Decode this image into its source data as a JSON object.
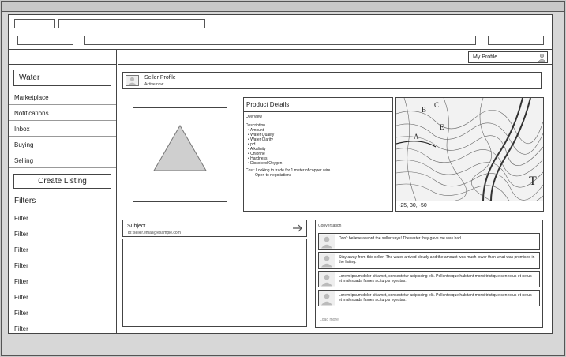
{
  "sidebar": {
    "search_value": "Water",
    "nav": [
      "Marketplace",
      "Notifications",
      "Inbox",
      "Buying",
      "Selling"
    ],
    "create_listing": "Create Listing",
    "filters_heading": "Filters",
    "filters": [
      "Filter",
      "Filter",
      "Filter",
      "Filter",
      "Filter",
      "Filter",
      "Filter",
      "Filter"
    ]
  },
  "header": {
    "profile_label": "My Profile"
  },
  "seller": {
    "title": "Seller Profile",
    "subtitle": "Active now"
  },
  "product": {
    "title": "Product Details",
    "overview": "Overview",
    "description_label": "Description",
    "attributes": [
      "Amount",
      "Water Quality",
      "Water Clarity",
      "pH",
      "Alkalinity",
      "Chlorine",
      "Hardness",
      "Dissolved Oxygen"
    ],
    "note_line1": "Cost: Looking to trade for 1 meter of copper wire",
    "note_line2": "Open to negotiations"
  },
  "map": {
    "labels": [
      "A",
      "B",
      "C",
      "E",
      "T"
    ],
    "caption": "-25, 30, -50"
  },
  "message": {
    "subject": "Subject",
    "to": "To: seller.email@example.com"
  },
  "messages": {
    "title": "Conversation",
    "items": [
      "Don't believe a word the seller says! The water they gave me was bad.",
      "Stay away from this seller! The water arrived cloudy and the amount was much lower than what was promised in the listing.",
      "Lorem ipsum dolor sit amet, consectetur adipiscing elit. Pellentesque habitant morbi tristique senectus et netus et malesuada fames ac turpis egestas.",
      "Lorem ipsum dolor sit amet, consectetur adipiscing elit. Pellentesque habitant morbi tristique senectus et netus et malesuada fames ac turpis egestas."
    ],
    "footer": "Load more"
  }
}
